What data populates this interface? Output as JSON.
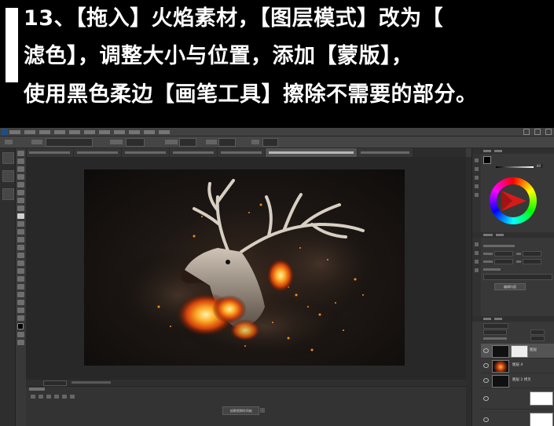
{
  "caption": {
    "line1": "13、【拖入】火焰素材，【图层模式】改为【",
    "line2": "滤色】，调整大小与位置，添加【蒙版】，",
    "line3": "使用黑色柔边【画笔工具】擦除不需要的部分。"
  },
  "photoshop": {
    "timeline_button": "创建视频时间轴",
    "properties_button": "编辑内容",
    "opacity_value": "80",
    "layers": [
      {
        "name": "图层",
        "selected": true,
        "thumb": "black",
        "has_mask": true
      },
      {
        "name": "图层 4",
        "selected": false,
        "thumb": "fire",
        "has_mask": false
      },
      {
        "name": "图层 2 拷贝",
        "selected": false,
        "thumb": "black",
        "has_mask": false
      },
      {
        "name": "",
        "selected": false,
        "thumb": "white",
        "has_mask": false
      },
      {
        "name": "",
        "selected": false,
        "thumb": "white",
        "has_mask": false
      }
    ]
  },
  "colors": {
    "banner_bg": "#000000",
    "banner_text": "#ffffff",
    "ps_bg": "#3a3a3a",
    "fire_orange": "#ff8a1a"
  }
}
